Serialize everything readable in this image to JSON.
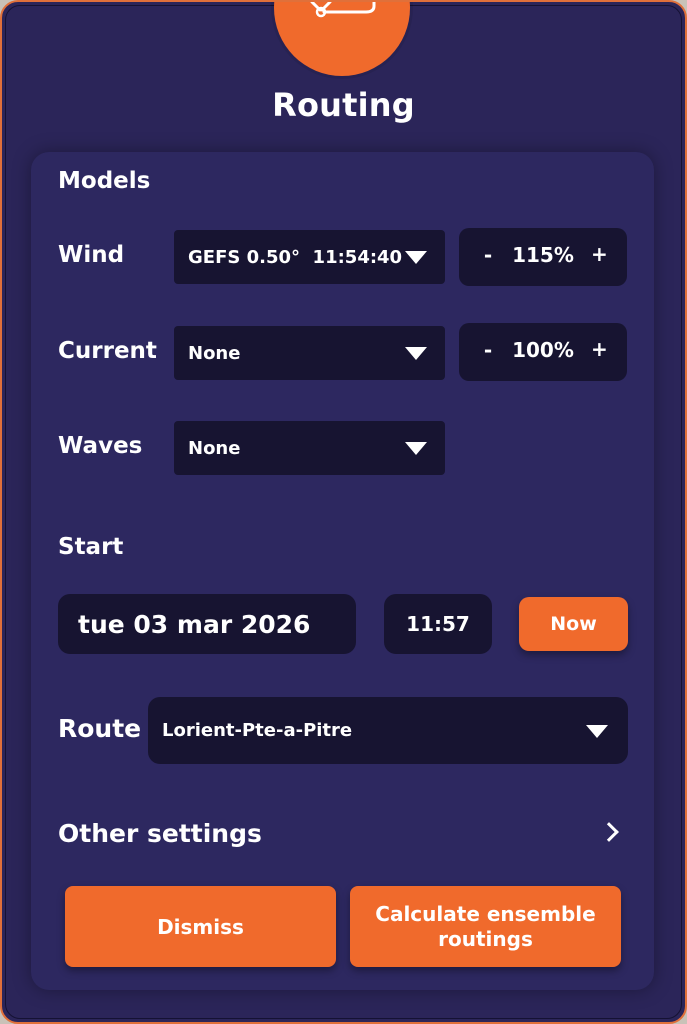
{
  "header": {
    "title": "Routing",
    "logo_icon": "route-icon"
  },
  "models": {
    "heading": "Models",
    "wind": {
      "label": "Wind",
      "selected": "GEFS 0.50°  11:54:40",
      "minus": "-",
      "factor": "115%",
      "plus": "+"
    },
    "current": {
      "label": "Current",
      "selected": "None",
      "minus": "-",
      "factor": "100%",
      "plus": "+"
    },
    "waves": {
      "label": "Waves",
      "selected": "None"
    }
  },
  "start": {
    "heading": "Start",
    "date": "tue 03 mar 2026",
    "time": "11:57",
    "now_label": "Now"
  },
  "route": {
    "label": "Route",
    "selected": "Lorient-Pte-a-Pitre"
  },
  "other_settings": {
    "label": "Other settings",
    "icon": "chevron-right-icon"
  },
  "actions": {
    "dismiss_label": "Dismiss",
    "calculate_line1": "Calculate ensemble",
    "calculate_line2": "routings"
  },
  "colors": {
    "accent": "#f06a2c",
    "panel": "#2b2559",
    "field": "#171431"
  }
}
